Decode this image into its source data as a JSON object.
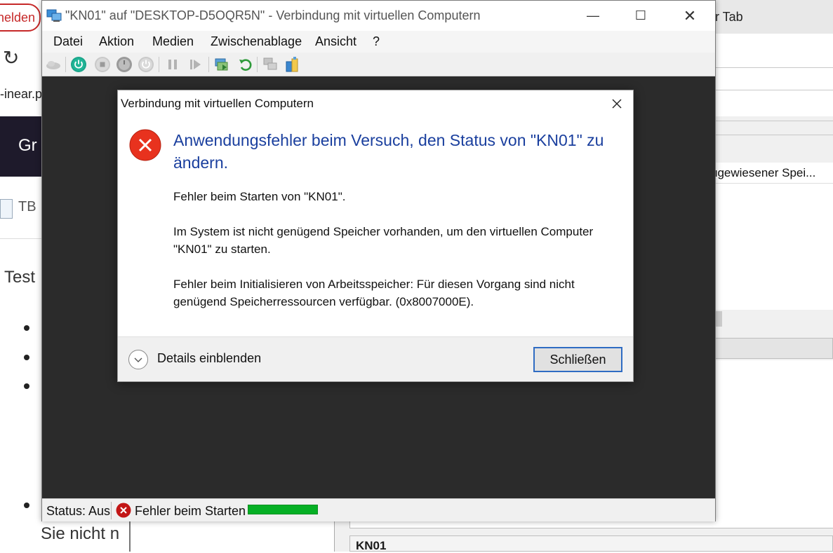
{
  "background_left": {
    "login_button": "nelden",
    "url_fragment": "-inear.p",
    "banner_text": "Gr",
    "tab_label": "TB",
    "heading_fragment": "Test",
    "bottom_text": "Sie nicht n"
  },
  "background_right": {
    "tab_text": "r Tab",
    "column_header": "ugewiesener Spei...",
    "vm_name": "KN01"
  },
  "vm_window": {
    "title": "\"KN01\" auf \"DESKTOP-D5OQR5N\" - Verbindung mit virtuellen Computern",
    "minimize_icon": "minimize-icon",
    "maximize_icon": "maximize-icon",
    "close_icon": "close-icon",
    "menu": [
      "Datei",
      "Aktion",
      "Medien",
      "Zwischenablage",
      "Ansicht",
      "?"
    ],
    "toolbar": [
      {
        "icon": "ctrl-alt-del-icon",
        "enabled": false
      },
      {
        "icon": "start-icon",
        "enabled": true
      },
      {
        "icon": "turn-off-icon",
        "enabled": false
      },
      {
        "icon": "shut-down-icon",
        "enabled": false
      },
      {
        "icon": "power-icon",
        "enabled": false
      },
      {
        "icon": "pause-icon",
        "enabled": false
      },
      {
        "icon": "resume-icon",
        "enabled": false
      },
      {
        "icon": "checkpoint-icon",
        "enabled": true
      },
      {
        "icon": "revert-icon",
        "enabled": true
      },
      {
        "icon": "enhanced-session-icon",
        "enabled": false
      },
      {
        "icon": "share-icon",
        "enabled": true
      }
    ],
    "status": {
      "state": "Status: Aus",
      "error": "Fehler beim Starten",
      "progress_color": "#06b025"
    }
  },
  "dialog": {
    "title": "Verbindung mit virtuellen Computern",
    "heading": "Anwendungsfehler beim Versuch, den Status von \"KN01\" zu ändern.",
    "paragraphs": [
      "Fehler beim Starten von \"KN01\".",
      "Im System ist nicht genügend Speicher vorhanden, um den virtuellen Computer \"KN01\" zu starten.",
      "Fehler beim Initialisieren von Arbeitsspeicher: Für diesen Vorgang sind nicht genügend Speicherressourcen verfügbar. (0x8007000E)."
    ],
    "details_label": "Details einblenden",
    "close_button": "Schließen",
    "heading_color": "#1a3f9e",
    "error_color": "#e8321e"
  }
}
